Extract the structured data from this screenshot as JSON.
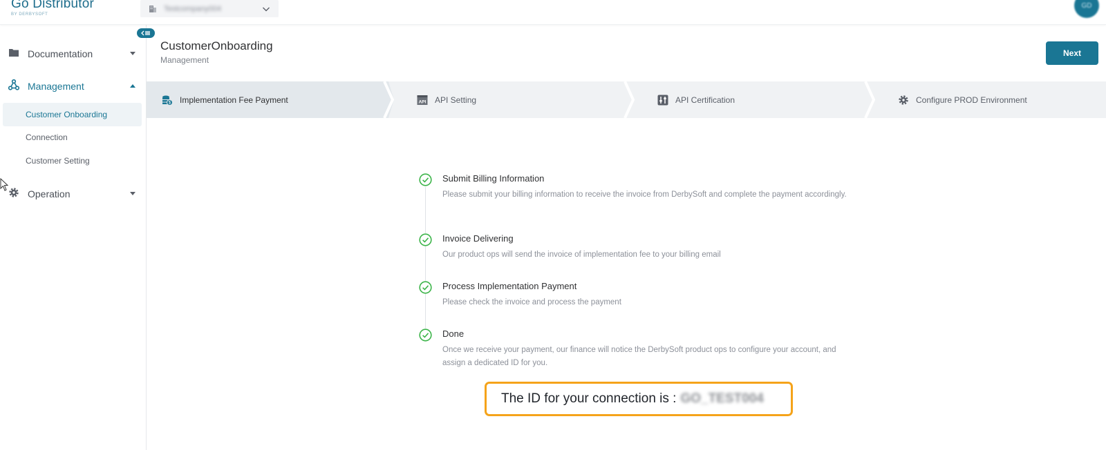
{
  "brand": {
    "name": "Go Distributor",
    "sub": "BY DERBYSOFT"
  },
  "company_select": {
    "value": "Testcompany004",
    "icon": "building-icon"
  },
  "user": {
    "initials": "GD"
  },
  "sidebar": {
    "groups": [
      {
        "label": "Documentation",
        "icon": "folder-icon",
        "expanded": false
      },
      {
        "label": "Management",
        "icon": "hub-icon",
        "expanded": true,
        "items": [
          {
            "label": "Customer Onboarding",
            "selected": true
          },
          {
            "label": "Connection",
            "selected": false
          },
          {
            "label": "Customer Setting",
            "selected": false
          }
        ]
      },
      {
        "label": "Operation",
        "icon": "gear-icon",
        "expanded": false
      }
    ]
  },
  "page": {
    "title": "CustomerOnboarding",
    "subtitle": "Management",
    "next_label": "Next"
  },
  "steps": [
    {
      "label": "Implementation Fee Payment",
      "icon": "coins-icon",
      "active": true
    },
    {
      "label": "API Setting",
      "icon": "api-icon",
      "active": false
    },
    {
      "label": "API Certification",
      "icon": "sliders-icon",
      "active": false
    },
    {
      "label": "Configure PROD Environment",
      "icon": "gear-icon",
      "active": false
    }
  ],
  "timeline": [
    {
      "title": "Submit Billing Information",
      "desc": "Please submit your billing information to receive the invoice from DerbySoft and complete the payment accordingly.",
      "status": "done"
    },
    {
      "title": "Invoice Delivering",
      "desc": "Our product ops will send the invoice of implementation fee to your billing email",
      "status": "done"
    },
    {
      "title": "Process Implementation Payment",
      "desc": "Please check the invoice and process the payment",
      "status": "done"
    },
    {
      "title": "Done",
      "desc": "Once we receive your payment, our finance will notice the DerbySoft product ops to configure your account, and assign a dedicated ID for you.",
      "status": "done"
    }
  ],
  "connection_id": {
    "label": "The ID for your connection is :",
    "value": "GO_TEST004"
  },
  "colors": {
    "accent": "#1a7694",
    "success": "#3cb449",
    "highlight": "#f5a31a"
  }
}
